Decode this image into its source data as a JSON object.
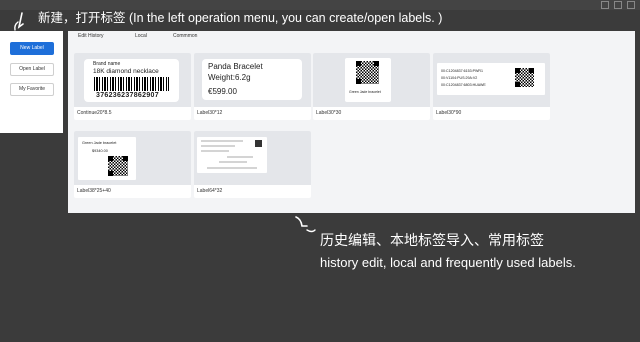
{
  "overlay": {
    "top_annotation": "新建，打开标签 (In the left operation menu, you can create/open labels. )",
    "bottom_annotation_cn": "历史编辑、本地标签导入、常用标签",
    "bottom_annotation_en": "history edit, local and frequently used labels."
  },
  "left_menu": {
    "new_label": "New Label",
    "open_label": "Open Label",
    "my_favorite": "My Favorite"
  },
  "tabs": [
    "Edit History",
    "Local",
    "Commmon"
  ],
  "cards": [
    {
      "caption": "Continue20*8.5",
      "label": {
        "line1": "Brand name",
        "line2": "18K diamond necklace",
        "barcode_number": "376236237862907"
      }
    },
    {
      "caption": "Label30*12",
      "label": {
        "line1": "Panda  Bracelet",
        "line2": "Weight:6.2g",
        "line3": "€599.00"
      }
    },
    {
      "caption": "Label30*30",
      "label": {
        "line1": "Green  Jade  bracelet"
      }
    },
    {
      "caption": "Label30*90",
      "label": {
        "line1": "00:C1204837:6153:PWR1",
        "line2": "00:V1104:PUS:29A:V2",
        "line3": "00:C1204837:6803:HUAWE"
      }
    },
    {
      "caption": "Label38*25+40",
      "label": {
        "line1": "Green  Jade  bracelet",
        "line2": "$9340.00"
      }
    },
    {
      "caption": "Label64*32",
      "label": {}
    }
  ],
  "colors": {
    "primary": "#1e6fd9",
    "background_dim": "#3b3b3b",
    "panel": "#f3f4f6"
  },
  "icons": [
    "cursor-click-icon",
    "cursor-click-icon"
  ]
}
